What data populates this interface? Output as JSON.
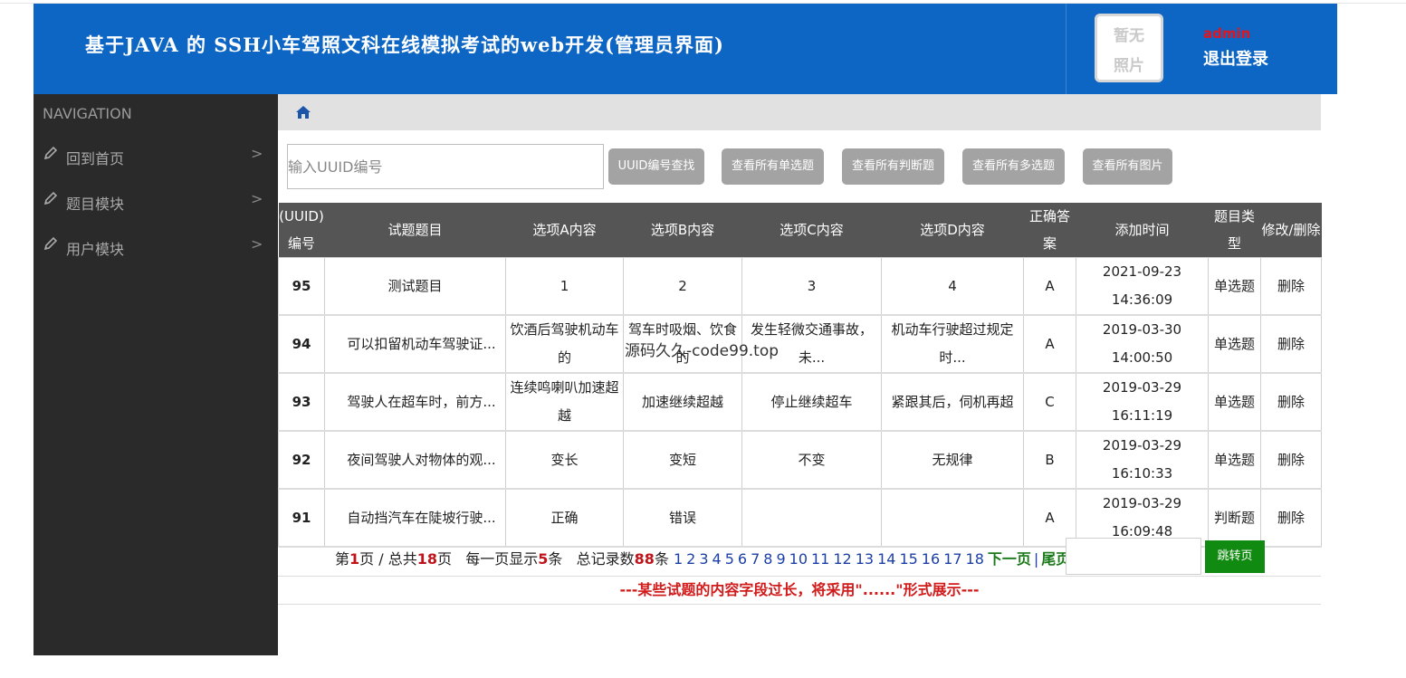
{
  "header": {
    "title": "基于JAVA 的 SSH小车驾照文科在线模拟考试的web开发(管理员界面)",
    "avatar_line1": "暂无",
    "avatar_line2": "照片",
    "admin_name": "admin",
    "logout_label": "退出登录"
  },
  "sidebar": {
    "heading": "NAVIGATION",
    "items": [
      {
        "label": "回到首页",
        "chevron": ">"
      },
      {
        "label": "题目模块",
        "chevron": ">"
      },
      {
        "label": "用户模块",
        "chevron": ">"
      }
    ]
  },
  "search": {
    "placeholder": "输入UUID编号",
    "buttons": [
      "UUID编号查找",
      "查看所有单选题",
      "查看所有判断题",
      "查看所有多选题",
      "查看所有图片"
    ]
  },
  "table": {
    "headers": [
      "(UUID)编号",
      "试题题目",
      "选项A内容",
      "选项B内容",
      "选项C内容",
      "选项D内容",
      "正确答案",
      "添加时间",
      "题目类型",
      "修改/删除"
    ],
    "rows": [
      {
        "id": "95",
        "title": "测试题目",
        "a": "1",
        "b": "2",
        "c": "3",
        "d": "4",
        "answer": "A",
        "time": "2021-09-23 14:36:09",
        "type": "单选题",
        "action": "删除"
      },
      {
        "id": "94",
        "title": "可以扣留机动车驾驶证...",
        "a": "饮酒后驾驶机动车的",
        "b": "驾车时吸烟、饮食的",
        "c": "发生轻微交通事故，未...",
        "d": "机动车行驶超过规定时...",
        "answer": "A",
        "time": "2019-03-30 14:00:50",
        "type": "单选题",
        "action": "删除"
      },
      {
        "id": "93",
        "title": "驾驶人在超车时，前方...",
        "a": "连续鸣喇叭加速超越",
        "b": "加速继续超越",
        "c": "停止继续超车",
        "d": "紧跟其后，伺机再超",
        "answer": "C",
        "time": "2019-03-29 16:11:19",
        "type": "单选题",
        "action": "删除"
      },
      {
        "id": "92",
        "title": "夜间驾驶人对物体的观...",
        "a": "变长",
        "b": "变短",
        "c": "不变",
        "d": "无规律",
        "answer": "B",
        "time": "2019-03-29 16:10:33",
        "type": "单选题",
        "action": "删除"
      },
      {
        "id": "91",
        "title": "自动挡汽车在陡坡行驶...",
        "a": "正确",
        "b": "错误",
        "c": "",
        "d": "",
        "answer": "A",
        "time": "2019-03-29 16:09:48",
        "type": "判断题",
        "action": "删除"
      }
    ]
  },
  "pager": {
    "prefix": "第",
    "current": "1",
    "mid1": "页 / 总共",
    "total_pages": "18",
    "mid2": "页   每一页显示",
    "per_page": "5",
    "mid3": "条   总记录数",
    "total_records": "88",
    "suffix": "条",
    "pages": [
      "1",
      "2",
      "3",
      "4",
      "5",
      "6",
      "7",
      "8",
      "9",
      "10",
      "11",
      "12",
      "13",
      "14",
      "15",
      "16",
      "17",
      "18"
    ],
    "next_label": "下一页",
    "last_label": "尾页",
    "jump_label": "跳转页"
  },
  "note": "---某些试题的内容字段过长，将采用\"......\"形式展示---",
  "watermark": "源码久久-code99.top",
  "colors": {
    "header_bg": "#0e66c4",
    "sidebar_bg": "#2a2a2a",
    "table_head_bg": "#555555",
    "accent_red": "#c0141c",
    "jump_btn": "#118a11"
  }
}
